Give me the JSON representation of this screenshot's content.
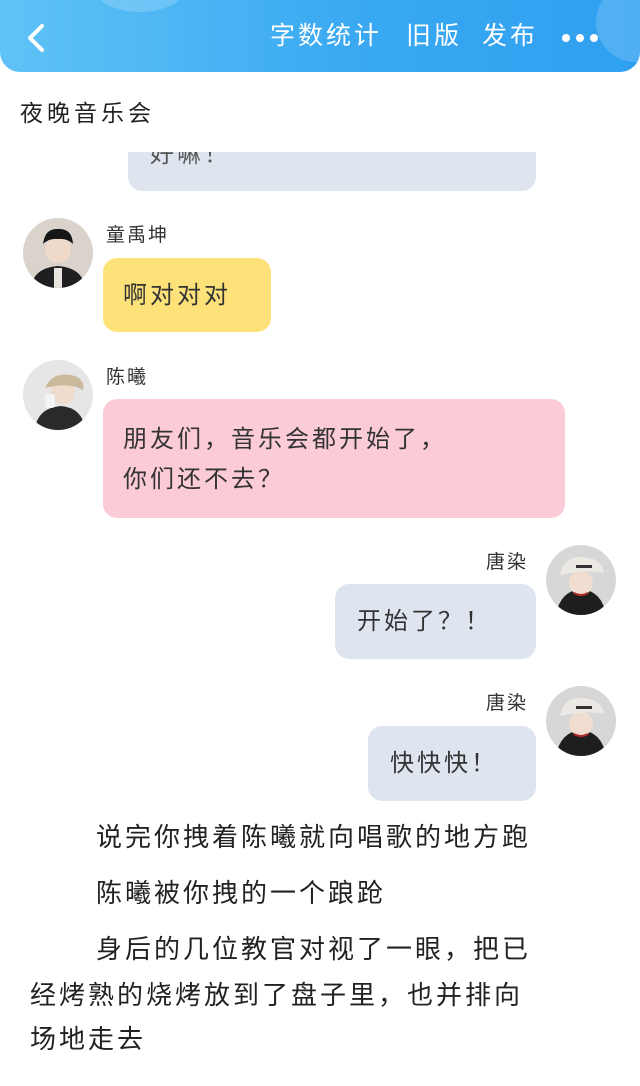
{
  "header": {
    "word_count_label": "字数统计",
    "old_version_label": "旧版",
    "publish_label": "发布"
  },
  "story": {
    "title": "夜晚音乐会"
  },
  "messages": [
    {
      "sender": "",
      "text": "好嘛！",
      "side": "left",
      "color": "#dfe5ef"
    },
    {
      "sender": "童禹坤",
      "text": "啊对对对",
      "side": "left",
      "color": "#fde27a"
    },
    {
      "sender": "陈曦",
      "text_line1": "朋友们，音乐会都开始了，",
      "text_line2": "你们还不去？",
      "side": "left",
      "color": "#fbcbd8"
    },
    {
      "sender": "唐染",
      "text": "开始了？！",
      "side": "right",
      "color": "#dfe5ef"
    },
    {
      "sender": "唐染",
      "text": "快快快！",
      "side": "right",
      "color": "#dfe5ef"
    }
  ],
  "narration": [
    "说完你拽着陈曦就向唱歌的地方跑",
    "陈曦被你拽的一个踉跄",
    "身后的几位教官对视了一眼，把已",
    "经烤熟的烧烤放到了盘子里，也并排向",
    "场地走去"
  ],
  "colors": {
    "header_start": "#5fc3f6",
    "header_end": "#2f9ff0",
    "bubble_grey": "#dfe5ef",
    "bubble_yellow": "#fde27a",
    "bubble_pink": "#fbcbd8"
  }
}
